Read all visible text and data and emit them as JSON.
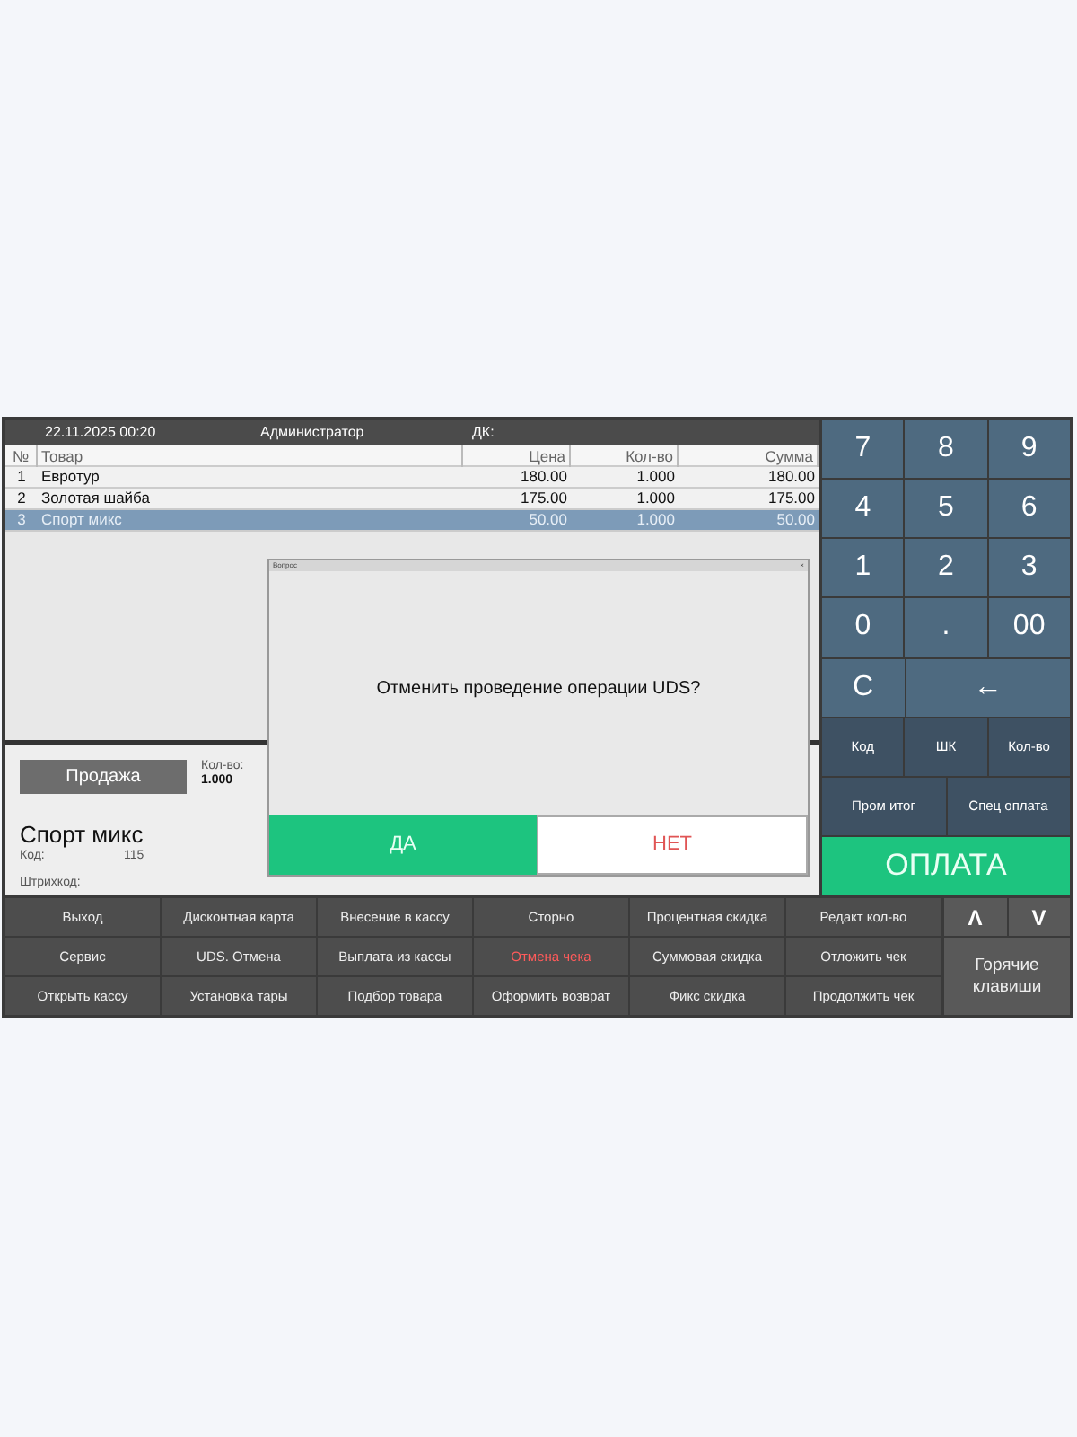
{
  "header": {
    "date": "22.11.2025 00:20",
    "user": "Администратор",
    "dk_label": "ДК:"
  },
  "table": {
    "columns": [
      "№",
      "Товар",
      "Цена",
      "Кол-во",
      "Сумма"
    ],
    "rows": [
      {
        "num": "1",
        "name": "Евротур",
        "price": "180.00",
        "qty": "1.000",
        "sum": "180.00",
        "selected": false
      },
      {
        "num": "2",
        "name": "Золотая шайба",
        "price": "175.00",
        "qty": "1.000",
        "sum": "175.00",
        "selected": false
      },
      {
        "num": "3",
        "name": "Спорт микс",
        "price": "50.00",
        "qty": "1.000",
        "sum": "50.00",
        "selected": true
      }
    ]
  },
  "sale": {
    "mode_button": "Продажа",
    "qty_label": "Кол-во:",
    "qty_value": "1.000",
    "product_name": "Спорт микс",
    "code_label": "Код:",
    "code_value": "115",
    "barcode_label": "Штрихкод:"
  },
  "dialog": {
    "title": "Вопрос",
    "close": "×",
    "message": "Отменить проведение операции UDS?",
    "buttons": [
      {
        "label": "ДА",
        "kind": "confirm"
      },
      {
        "label": "НЕТ",
        "kind": "cancel"
      }
    ]
  },
  "keypad": [
    [
      "7",
      "8",
      "9"
    ],
    [
      "4",
      "5",
      "6"
    ],
    [
      "1",
      "2",
      "3"
    ],
    [
      "0",
      ".",
      "00"
    ],
    [
      "C",
      "←"
    ]
  ],
  "function_keys": [
    [
      "Код",
      "ШК",
      "Кол-во"
    ],
    [
      "Пром итог",
      "Спец оплата"
    ]
  ],
  "pay_button": "ОПЛАТА",
  "bottom_buttons": [
    [
      {
        "label": "Выход",
        "kind": "normal"
      },
      {
        "label": "Дисконтная карта",
        "kind": "normal"
      },
      {
        "label": "Внесение в кассу",
        "kind": "normal"
      },
      {
        "label": "Сторно",
        "kind": "normal"
      },
      {
        "label": "Процентная скидка",
        "kind": "normal"
      },
      {
        "label": "Редакт кол-во",
        "kind": "normal"
      }
    ],
    [
      {
        "label": "Сервис",
        "kind": "normal"
      },
      {
        "label": "UDS. Отмена",
        "kind": "normal"
      },
      {
        "label": "Выплата из кассы",
        "kind": "normal"
      },
      {
        "label": "Отмена чека",
        "kind": "danger"
      },
      {
        "label": "Суммовая скидка",
        "kind": "normal"
      },
      {
        "label": "Отложить чек",
        "kind": "normal"
      }
    ],
    [
      {
        "label": "Открыть кассу",
        "kind": "normal"
      },
      {
        "label": "Установка тары",
        "kind": "normal"
      },
      {
        "label": "Подбор товара",
        "kind": "normal"
      },
      {
        "label": "Оформить возврат",
        "kind": "normal"
      },
      {
        "label": "Фикс скидка",
        "kind": "normal"
      },
      {
        "label": "Продолжить чек",
        "kind": "normal"
      }
    ]
  ],
  "nav_keys": [
    "Λ",
    "V"
  ],
  "hot_keys": "Горячие клавиши"
}
